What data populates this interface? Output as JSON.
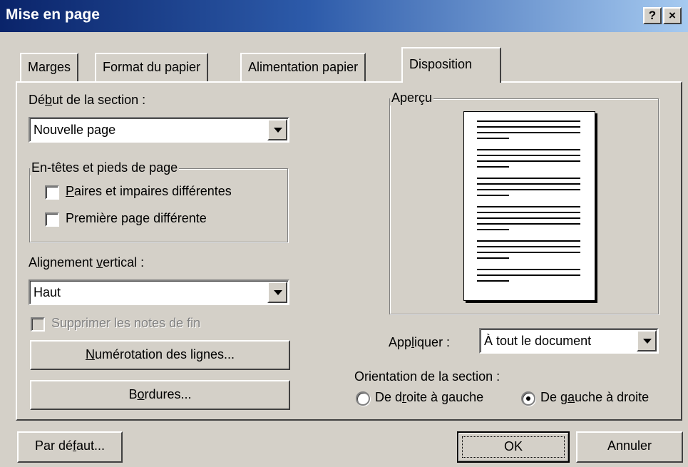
{
  "window": {
    "title": "Mise en page",
    "help_button": "?",
    "close_button": "×"
  },
  "tabs": [
    {
      "label": "Marges"
    },
    {
      "label": "Format du papier"
    },
    {
      "label": "Alimentation papier"
    },
    {
      "label": "Disposition",
      "active": true
    }
  ],
  "section_start": {
    "label_pre": "Dé",
    "label_key": "b",
    "label_post": "ut de la section :",
    "value": "Nouvelle page"
  },
  "headers_footers": {
    "legend": "En-têtes et pieds de page",
    "odd_even": {
      "key": "P",
      "rest": "aires et impaires différentes",
      "checked": false
    },
    "first_page": {
      "pre": "Première pa",
      "key": "g",
      "post": "e différente",
      "checked": false
    }
  },
  "vertical_alignment": {
    "label_pre": "Alignement ",
    "label_key": "v",
    "label_post": "ertical :",
    "value": "Haut"
  },
  "suppress_endnotes": {
    "label": "Supprimer les notes de fin",
    "checked": false,
    "enabled": false
  },
  "buttons": {
    "line_numbers": {
      "key": "N",
      "rest": "umérotation des lignes..."
    },
    "borders": {
      "pre": "B",
      "key": "o",
      "post": "rdures..."
    },
    "default": {
      "pre": "Par dé",
      "key": "f",
      "post": "aut..."
    },
    "ok": "OK",
    "cancel": "Annuler"
  },
  "preview": {
    "legend": "Aperçu"
  },
  "apply_to": {
    "label_pre": "App",
    "label_key": "l",
    "label_post": "iquer :",
    "value": "À tout le document"
  },
  "orientation": {
    "label": "Orientation de la section :",
    "rtl": {
      "pre": "De d",
      "key": "r",
      "post": "oite à gauche",
      "selected": false
    },
    "ltr": {
      "pre": "De g",
      "key": "a",
      "post": "uche à droite",
      "selected": true
    }
  }
}
